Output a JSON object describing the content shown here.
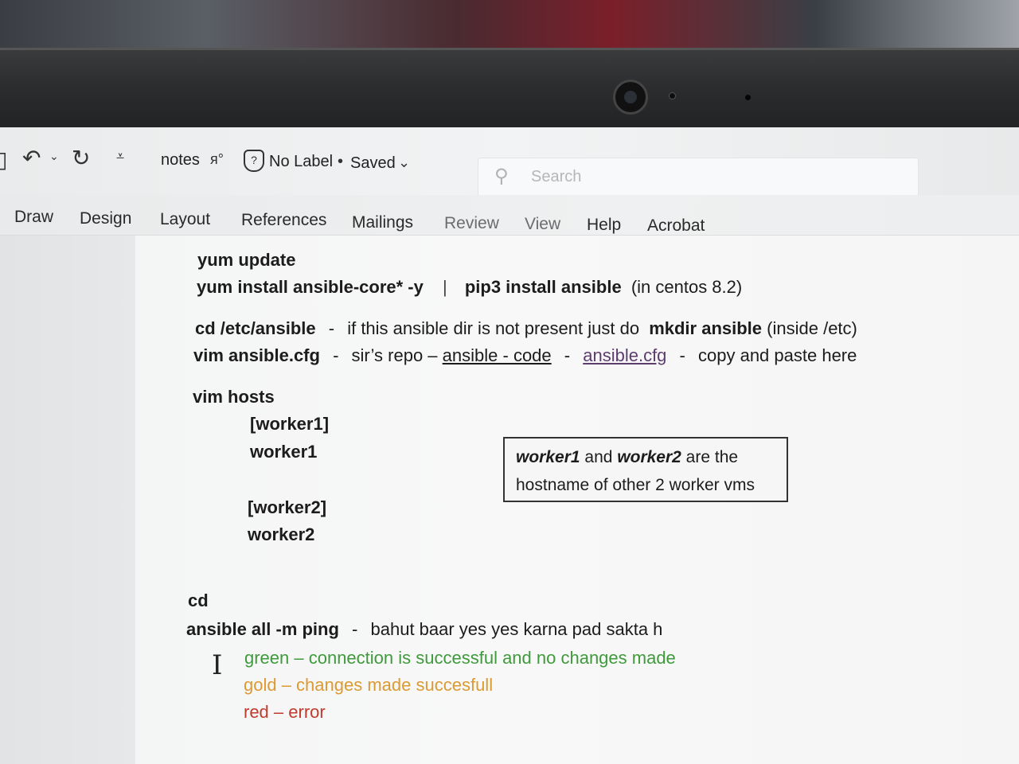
{
  "titlebar": {
    "doc_name": "notes",
    "label": "No Label",
    "status": "Saved",
    "search_placeholder": "Search"
  },
  "ribbon": {
    "tabs": [
      "Draw",
      "Design",
      "Layout",
      "References",
      "Mailings",
      "Review",
      "View",
      "Help",
      "Acrobat"
    ]
  },
  "document": {
    "l1": "yum update",
    "l2_cmd": "yum install ansible-core* -y",
    "l2_sep": "|",
    "l2_pip": "pip3 install ansible",
    "l2_note": "(in centos 8.2)",
    "l3_cmd": "cd /etc/ansible",
    "l3_dash": "-",
    "l3_text": "if this ansible dir is not present just do",
    "l3_mkdir": "mkdir ansible",
    "l3_inside": "(inside /etc)",
    "l4_cmd": "vim ansible.cfg",
    "l4_dash": "-",
    "l4_text": "sir’s repo –",
    "l4_link1": "ansible - code",
    "l4_dash2": "-",
    "l4_link2": "ansible.cfg",
    "l4_dash3": "-",
    "l4_copy": "copy and paste here",
    "l5": "vim hosts",
    "h1": "[worker1]",
    "h2": "worker1",
    "h3": "[worker2]",
    "h4": "worker2",
    "box_w1": "worker1",
    "box_and": "and",
    "box_w2": "worker2",
    "box_rest1": "are the",
    "box_rest2": "hostname of other 2 worker vms",
    "l6": "cd",
    "l7_cmd": "ansible all -m ping",
    "l7_dash": "-",
    "l7_text": "bahut baar yes yes karna pad sakta h",
    "green": "green – connection is successful and no changes made",
    "gold": "gold – changes made succesfull",
    "red": "red – error"
  },
  "colors": {
    "green": "#3f9a3c",
    "gold": "#dc9a32",
    "red": "#c03a2e",
    "visited_link": "#5c3d6c"
  }
}
